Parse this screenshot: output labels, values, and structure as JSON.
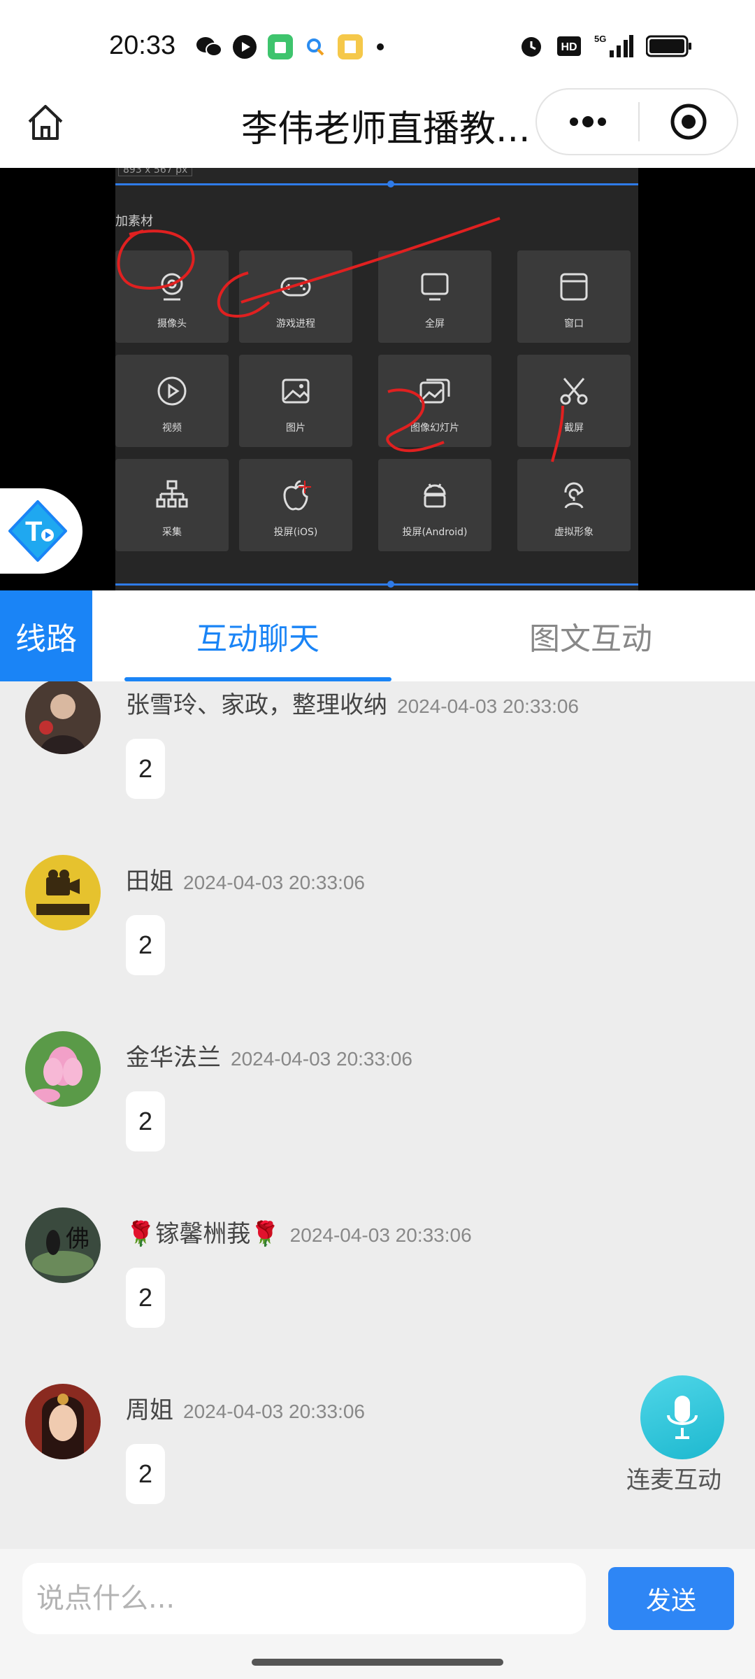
{
  "status_bar": {
    "time": "20:33",
    "hd_label": "HD",
    "network": "5G"
  },
  "title_bar": {
    "title": "李伟老师直播教..."
  },
  "video": {
    "size_label": "893 x 567 px",
    "section_title": "加素材",
    "tiles": [
      {
        "label": "摄像头",
        "icon": "camera-icon"
      },
      {
        "label": "游戏进程",
        "icon": "gamepad-icon"
      },
      {
        "label": "全屏",
        "icon": "monitor-icon"
      },
      {
        "label": "窗口",
        "icon": "window-icon"
      },
      {
        "label": "视频",
        "icon": "play-icon"
      },
      {
        "label": "图片",
        "icon": "image-icon"
      },
      {
        "label": "图像幻灯片",
        "icon": "slideshow-icon"
      },
      {
        "label": "截屏",
        "icon": "scissors-icon"
      },
      {
        "label": "采集",
        "icon": "capture-icon"
      },
      {
        "label": "投屏(iOS)",
        "icon": "apple-icon"
      },
      {
        "label": "投屏(Android)",
        "icon": "android-icon"
      },
      {
        "label": "虚拟形象",
        "icon": "avatar-icon"
      }
    ]
  },
  "tabs": {
    "line": "线路",
    "chat": "互动聊天",
    "graphic": "图文互动"
  },
  "messages": [
    {
      "name": "张雪玲、家政，整理收纳",
      "time": "2024-04-03 20:33:06",
      "text": "2"
    },
    {
      "name": "田姐",
      "time": "2024-04-03 20:33:06",
      "text": "2"
    },
    {
      "name": "金华法兰",
      "time": "2024-04-03 20:33:06",
      "text": "2"
    },
    {
      "name": "🌹镓馨栦莪🌹",
      "time": "2024-04-03 20:33:06",
      "text": "2"
    },
    {
      "name": "周姐",
      "time": "2024-04-03 20:33:06",
      "text": "2"
    }
  ],
  "mic": {
    "label": "连麦互动"
  },
  "input": {
    "placeholder": "说点什么...",
    "send": "发送"
  }
}
